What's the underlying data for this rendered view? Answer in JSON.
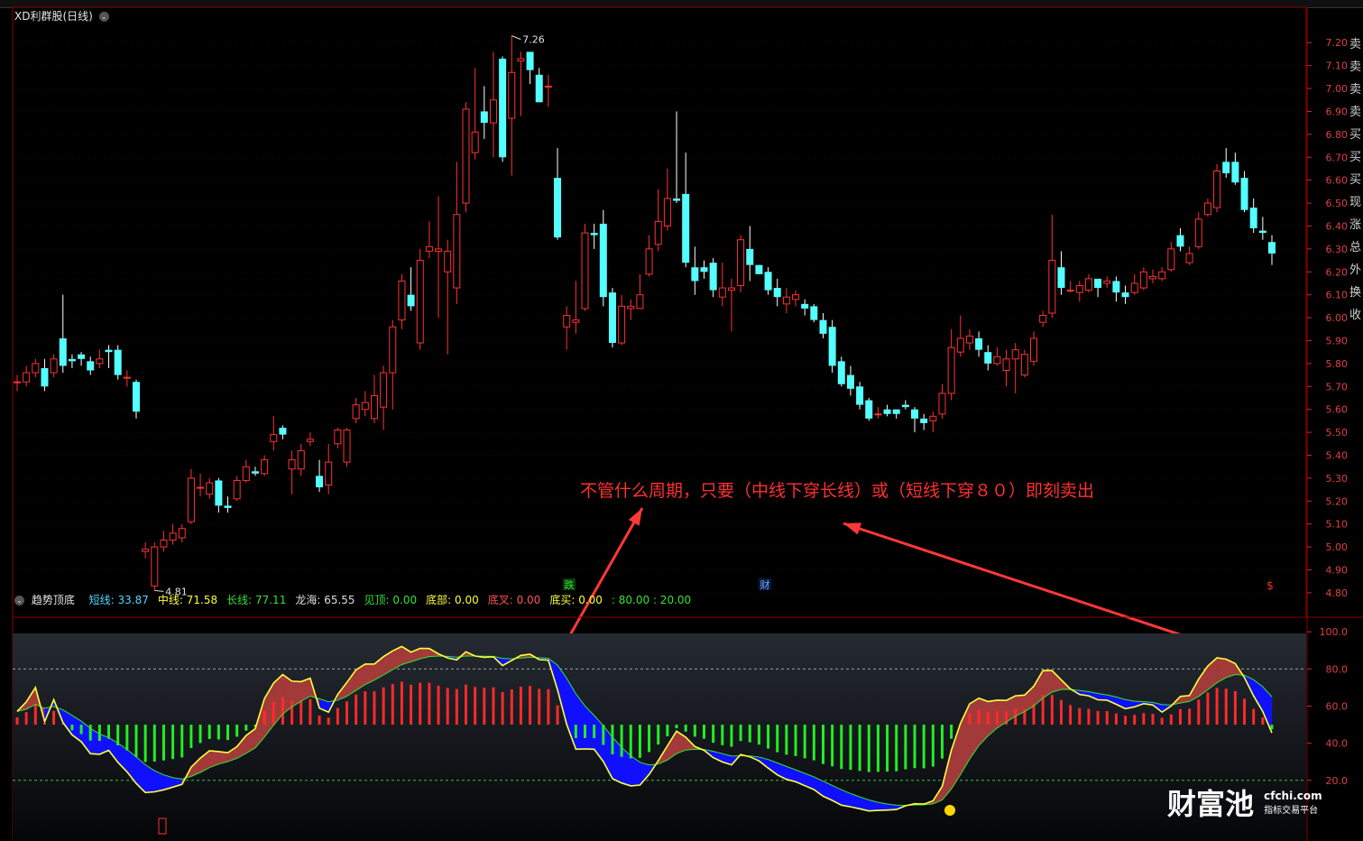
{
  "stock": {
    "title": "XD利群股(日线)"
  },
  "indicator": {
    "name": "趋势顶底",
    "params": [
      {
        "label": "短线:",
        "value": "33.87",
        "color": "#4fd8ff"
      },
      {
        "label": "中线:",
        "value": "71.58",
        "color": "#ffff3c"
      },
      {
        "label": "长线:",
        "value": "77.11",
        "color": "#34e234"
      },
      {
        "label": "龙海:",
        "value": "65.55",
        "color": "#dddddd"
      },
      {
        "label": "见顶:",
        "value": "0.00",
        "color": "#34e234"
      },
      {
        "label": "底部:",
        "value": "0.00",
        "color": "#ffff3c"
      },
      {
        "label": "底叉:",
        "value": "0.00",
        "color": "#ff5555"
      },
      {
        "label": "底买:",
        "value": "0.00",
        "color": "#ffff3c"
      },
      {
        "label": ":",
        "value": "80.00 : 20.00",
        "color": "#34e234"
      }
    ]
  },
  "annotation": {
    "text": "不管什么周期，只要（中线下穿长线）或（短线下穿８０）即刻卖出",
    "color": "#ff3030"
  },
  "labels": {
    "high": "7.26",
    "low": "4.81",
    "die": "跌",
    "cai": "财",
    "dollar": "$"
  },
  "watermark": {
    "logo": "财富池",
    "site": "cfchi.com",
    "tagline": "指标交易平台"
  },
  "sidebar": {
    "chars": [
      "卖",
      "卖",
      "卖",
      "卖",
      "买",
      "买",
      "买",
      "现",
      "涨",
      "总",
      "外",
      "换",
      "收"
    ]
  },
  "colors": {
    "up": "#ff3232",
    "down": "#54ffff",
    "bg": "#000000",
    "grid": "#7a0000"
  },
  "chart_data": {
    "type": "candlestick",
    "price_axis": {
      "ticks": [
        7.2,
        7.1,
        7.0,
        6.9,
        6.8,
        6.7,
        6.6,
        6.5,
        6.4,
        6.3,
        6.2,
        6.1,
        6.0,
        5.9,
        5.8,
        5.7,
        5.6,
        5.5,
        5.4,
        5.3,
        5.2,
        5.1,
        5.0,
        4.9,
        4.8
      ],
      "range": [
        4.78,
        7.26
      ]
    },
    "candles": [
      [
        5.72,
        5.72,
        5.68,
        5.75
      ],
      [
        5.72,
        5.76,
        5.7,
        5.79
      ],
      [
        5.76,
        5.8,
        5.74,
        5.82
      ],
      [
        5.78,
        5.7,
        5.68,
        5.82
      ],
      [
        5.76,
        5.82,
        5.74,
        5.84
      ],
      [
        5.91,
        5.79,
        5.76,
        6.1
      ],
      [
        5.82,
        5.81,
        5.78,
        5.84
      ],
      [
        5.84,
        5.82,
        5.79,
        5.85
      ],
      [
        5.81,
        5.77,
        5.75,
        5.83
      ],
      [
        5.8,
        5.82,
        5.78,
        5.86
      ],
      [
        5.86,
        5.85,
        5.78,
        5.88
      ],
      [
        5.86,
        5.75,
        5.73,
        5.88
      ],
      [
        5.74,
        5.74,
        5.7,
        5.77
      ],
      [
        5.72,
        5.59,
        5.56,
        5.73
      ],
      [
        4.98,
        4.99,
        4.95,
        5.02
      ],
      [
        4.83,
        5.0,
        4.81,
        5.02
      ],
      [
        5.0,
        5.03,
        4.98,
        5.07
      ],
      [
        5.03,
        5.06,
        5.01,
        5.1
      ],
      [
        5.04,
        5.08,
        5.02,
        5.1
      ],
      [
        5.11,
        5.3,
        5.1,
        5.34
      ],
      [
        5.26,
        5.26,
        5.22,
        5.32
      ],
      [
        5.23,
        5.28,
        5.21,
        5.3
      ],
      [
        5.29,
        5.18,
        5.15,
        5.3
      ],
      [
        5.18,
        5.17,
        5.15,
        5.22
      ],
      [
        5.21,
        5.29,
        5.2,
        5.31
      ],
      [
        5.29,
        5.35,
        5.28,
        5.38
      ],
      [
        5.33,
        5.32,
        5.31,
        5.35
      ],
      [
        5.32,
        5.38,
        5.31,
        5.4
      ],
      [
        5.46,
        5.49,
        5.42,
        5.57
      ],
      [
        5.52,
        5.49,
        5.47,
        5.53
      ],
      [
        5.34,
        5.38,
        5.23,
        5.42
      ],
      [
        5.34,
        5.42,
        5.31,
        5.45
      ],
      [
        5.46,
        5.47,
        5.44,
        5.5
      ],
      [
        5.31,
        5.26,
        5.24,
        5.38
      ],
      [
        5.27,
        5.37,
        5.23,
        5.45
      ],
      [
        5.45,
        5.51,
        5.43,
        5.52
      ],
      [
        5.37,
        5.51,
        5.35,
        5.52
      ],
      [
        5.56,
        5.62,
        5.54,
        5.65
      ],
      [
        5.6,
        5.63,
        5.57,
        5.68
      ],
      [
        5.56,
        5.66,
        5.54,
        5.75
      ],
      [
        5.61,
        5.76,
        5.51,
        5.79
      ],
      [
        5.76,
        5.96,
        5.6,
        5.99
      ],
      [
        5.99,
        6.16,
        5.95,
        6.19
      ],
      [
        6.1,
        6.05,
        6.03,
        6.22
      ],
      [
        5.89,
        6.25,
        5.86,
        6.3
      ],
      [
        6.29,
        6.31,
        6.26,
        6.42
      ],
      [
        6.29,
        6.3,
        6.0,
        6.53
      ],
      [
        6.2,
        6.29,
        5.84,
        6.34
      ],
      [
        6.13,
        6.45,
        6.06,
        6.68
      ],
      [
        6.5,
        6.91,
        6.46,
        6.94
      ],
      [
        6.72,
        6.81,
        6.69,
        7.09
      ],
      [
        6.9,
        6.85,
        6.78,
        7.01
      ],
      [
        6.85,
        6.95,
        6.7,
        7.16
      ],
      [
        7.13,
        6.7,
        6.68,
        7.14
      ],
      [
        6.87,
        7.07,
        6.62,
        7.23
      ],
      [
        7.12,
        7.13,
        6.88,
        7.16
      ],
      [
        7.16,
        7.08,
        7.02,
        7.13
      ],
      [
        7.06,
        6.94,
        6.94,
        7.09
      ],
      [
        7.01,
        7.01,
        6.92,
        7.06
      ],
      [
        6.61,
        6.35,
        6.34,
        6.74
      ],
      [
        5.96,
        6.01,
        5.86,
        6.05
      ],
      [
        5.98,
        5.99,
        5.93,
        6.16
      ],
      [
        6.04,
        6.37,
        6.03,
        6.41
      ],
      [
        6.37,
        6.36,
        6.3,
        6.41
      ],
      [
        6.41,
        6.09,
        6.05,
        6.47
      ],
      [
        6.11,
        5.89,
        5.87,
        6.13
      ],
      [
        5.89,
        6.05,
        5.88,
        6.1
      ],
      [
        6.04,
        6.05,
        5.99,
        6.08
      ],
      [
        6.04,
        6.1,
        6.04,
        6.19
      ],
      [
        6.19,
        6.3,
        6.18,
        6.36
      ],
      [
        6.32,
        6.42,
        6.29,
        6.56
      ],
      [
        6.4,
        6.52,
        6.38,
        6.65
      ],
      [
        6.52,
        6.51,
        6.5,
        6.9
      ],
      [
        6.54,
        6.24,
        6.22,
        6.72
      ],
      [
        6.22,
        6.16,
        6.1,
        6.31
      ],
      [
        6.22,
        6.2,
        6.17,
        6.25
      ],
      [
        6.24,
        6.12,
        6.09,
        6.26
      ],
      [
        6.09,
        6.13,
        6.05,
        6.24
      ],
      [
        6.12,
        6.13,
        5.94,
        6.17
      ],
      [
        6.14,
        6.34,
        6.11,
        6.36
      ],
      [
        6.3,
        6.23,
        6.16,
        6.4
      ],
      [
        6.23,
        6.19,
        6.19,
        6.23
      ],
      [
        6.2,
        6.12,
        6.1,
        6.22
      ],
      [
        6.13,
        6.09,
        6.05,
        6.17
      ],
      [
        6.06,
        6.09,
        6.02,
        6.13
      ],
      [
        6.08,
        6.1,
        6.05,
        6.12
      ],
      [
        6.06,
        6.04,
        6.01,
        6.08
      ],
      [
        6.05,
        5.99,
        5.98,
        6.06
      ],
      [
        5.99,
        5.93,
        5.91,
        6.02
      ],
      [
        5.96,
        5.79,
        5.76,
        5.99
      ],
      [
        5.81,
        5.71,
        5.7,
        5.83
      ],
      [
        5.75,
        5.69,
        5.66,
        5.79
      ],
      [
        5.7,
        5.62,
        5.6,
        5.72
      ],
      [
        5.64,
        5.56,
        5.55,
        5.65
      ],
      [
        5.58,
        5.58,
        5.56,
        5.61
      ],
      [
        5.6,
        5.58,
        5.57,
        5.62
      ],
      [
        5.6,
        5.58,
        5.56,
        5.6
      ],
      [
        5.62,
        5.61,
        5.6,
        5.64
      ],
      [
        5.6,
        5.56,
        5.5,
        5.61
      ],
      [
        5.56,
        5.54,
        5.51,
        5.58
      ],
      [
        5.55,
        5.57,
        5.5,
        5.59
      ],
      [
        5.58,
        5.67,
        5.56,
        5.71
      ],
      [
        5.67,
        5.87,
        5.64,
        5.95
      ],
      [
        5.85,
        5.91,
        5.83,
        6.01
      ],
      [
        5.89,
        5.92,
        5.86,
        5.95
      ],
      [
        5.91,
        5.86,
        5.83,
        5.94
      ],
      [
        5.85,
        5.8,
        5.77,
        5.88
      ],
      [
        5.8,
        5.83,
        5.79,
        5.87
      ],
      [
        5.77,
        5.82,
        5.7,
        5.86
      ],
      [
        5.82,
        5.86,
        5.67,
        5.89
      ],
      [
        5.75,
        5.84,
        5.74,
        5.86
      ],
      [
        5.81,
        5.91,
        5.79,
        5.94
      ],
      [
        5.98,
        6.01,
        5.96,
        6.03
      ],
      [
        6.02,
        6.25,
        6.0,
        6.45
      ],
      [
        6.22,
        6.13,
        6.1,
        6.29
      ],
      [
        6.12,
        6.12,
        6.11,
        6.16
      ],
      [
        6.11,
        6.14,
        6.07,
        6.16
      ],
      [
        6.12,
        6.17,
        6.11,
        6.19
      ],
      [
        6.17,
        6.13,
        6.09,
        6.17
      ],
      [
        6.15,
        6.16,
        6.13,
        6.18
      ],
      [
        6.16,
        6.11,
        6.07,
        6.18
      ],
      [
        6.11,
        6.09,
        6.06,
        6.14
      ],
      [
        6.11,
        6.15,
        6.1,
        6.19
      ],
      [
        6.13,
        6.2,
        6.12,
        6.22
      ],
      [
        6.17,
        6.18,
        6.15,
        6.21
      ],
      [
        6.17,
        6.2,
        6.16,
        6.22
      ],
      [
        6.21,
        6.3,
        6.2,
        6.33
      ],
      [
        6.36,
        6.31,
        6.29,
        6.39
      ],
      [
        6.24,
        6.28,
        6.23,
        6.31
      ],
      [
        6.31,
        6.43,
        6.3,
        6.46
      ],
      [
        6.45,
        6.5,
        6.44,
        6.52
      ],
      [
        6.48,
        6.64,
        6.46,
        6.67
      ],
      [
        6.68,
        6.63,
        6.61,
        6.74
      ],
      [
        6.68,
        6.59,
        6.58,
        6.72
      ],
      [
        6.61,
        6.47,
        6.46,
        6.64
      ],
      [
        6.48,
        6.39,
        6.37,
        6.52
      ],
      [
        6.38,
        6.37,
        6.34,
        6.44
      ],
      [
        6.33,
        6.28,
        6.23,
        6.36
      ]
    ],
    "indicator_axis": {
      "ticks": [
        100,
        80,
        60,
        40,
        20
      ],
      "range": [
        0,
        110
      ]
    },
    "indicator_lines": {
      "upper": 80,
      "lower": 20
    }
  }
}
